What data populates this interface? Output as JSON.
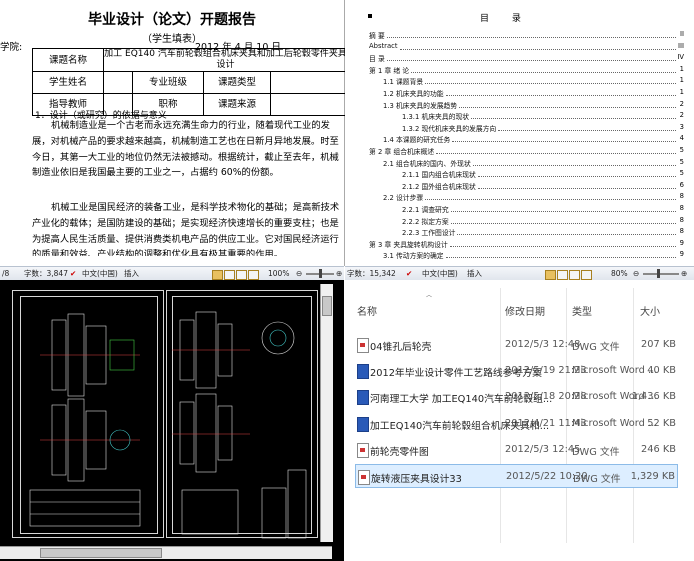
{
  "doc": {
    "title": "毕业设计（论文）开题报告",
    "subtitle": "（学生填表）",
    "school_label": "学院:",
    "date": "2012 年 4 月 10 日",
    "table": {
      "topic_label": "课题名称",
      "topic_value": "加工 EQ140 汽车前轮毂组合机床夹具和加工后轮毂零件夹具设计",
      "student_label": "学生姓名",
      "major_label": "专业班级",
      "type_label": "课题类型",
      "advisor_label": "指导教师",
      "title_label": "职称",
      "source_label": "课题来源"
    },
    "section_heading": "1．设计（或研究）的依据与意义",
    "para1": "机械制造业是一个古老而永远充满生命力的行业，随着现代工业的发展，对机械产品的要求越来越高，机械制造工艺也在日新月异地发展。时至今日，其第一大工业的地位仍然无法被撼动。根据统计，截止至去年，机械制造业依旧是我国最主要的工业之一，占据约 60%的份额。",
    "para2": "机械工业是国民经济的装备工业，是科学技术物化的基础；是高新技术产业化的载体；是国防建设的基础；是实现经济快速增长的重要支柱；也是为提高人民生活质量、提供消费类机电产品的供应工业。它对国民经济运行的质量和效益、产业结构的调整和优化具有极其重要的作用。",
    "status": {
      "page": "/8",
      "words": "字数：3,847",
      "lang": "中文(中国)",
      "mode": "插入",
      "zoom": "100%"
    }
  },
  "toc": {
    "title": "目 录",
    "entries": [
      {
        "text": "摘 要",
        "page": "II"
      },
      {
        "text": "Abstract",
        "page": "III"
      },
      {
        "text": "目 录",
        "page": "IV"
      },
      {
        "text": "第 1 章 绪 论",
        "page": "1"
      },
      {
        "text": "1.1 课题背景",
        "page": "1"
      },
      {
        "text": "1.2 机床夹具的功能",
        "page": "1"
      },
      {
        "text": "1.3 机床夹具的发展趋势",
        "page": "2"
      },
      {
        "text": "1.3.1 机床夹具的现状",
        "page": "2"
      },
      {
        "text": "1.3.2 现代机床夹具的发展方向",
        "page": "3"
      },
      {
        "text": "1.4 本课题的研究任务",
        "page": "4"
      },
      {
        "text": "第 2 章 组合机床概述",
        "page": "5"
      },
      {
        "text": "2.1 组合机床的国内、外现状",
        "page": "5"
      },
      {
        "text": "2.1.1 国内组合机床现状",
        "page": "5"
      },
      {
        "text": "2.1.2 国外组合机床现状",
        "page": "6"
      },
      {
        "text": "2.2 设计步骤",
        "page": "8"
      },
      {
        "text": "2.2.1 调查研究",
        "page": "8"
      },
      {
        "text": "2.2.2 拟定方案",
        "page": "8"
      },
      {
        "text": "2.2.3 工作图设计",
        "page": "8"
      },
      {
        "text": "第 3 章 夹具旋转机构设计",
        "page": "9"
      },
      {
        "text": "3.1 传动方案的确定",
        "page": "9"
      }
    ],
    "status": {
      "words": "字数：15,342",
      "lang": "中文(中国)",
      "mode": "插入",
      "zoom": "80%"
    }
  },
  "cad_status": {
    "words": "字数：3,847",
    "lang": "中文(中国)",
    "mode": "插入",
    "zoom": "100%"
  },
  "files": {
    "headers": {
      "name": "名称",
      "date": "修改日期",
      "type": "类型",
      "size": "大小"
    },
    "rows": [
      {
        "name": "04锥孔后轮壳",
        "date": "2012/5/3 12:48",
        "type": "DWG 文件",
        "size": "207 KB",
        "icon": "dwg-file-icon"
      },
      {
        "name": "2012年毕业设计零件工艺路线参考方案",
        "date": "2012/5/19 21:23",
        "type": "Microsoft Word ...",
        "size": "40 KB",
        "icon": "word-file-icon"
      },
      {
        "name": "河南理工大学 加工EQ140汽车前轮毂组...",
        "date": "2012/5/18 20:28",
        "type": "Microsoft Word ...",
        "size": "1,436 KB",
        "icon": "word-file-icon"
      },
      {
        "name": "加工EQ140汽车前轮毂组合机床夹具和...",
        "date": "2012/4/21 11:43",
        "type": "Microsoft Word ...",
        "size": "52 KB",
        "icon": "word-file-icon"
      },
      {
        "name": "前轮壳零件图",
        "date": "2012/5/3 12:45",
        "type": "DWG 文件",
        "size": "246 KB",
        "icon": "dwg-file-icon"
      },
      {
        "name": "旋转液压夹具设计33",
        "date": "2012/5/22 10:20",
        "type": "DWG 文件",
        "size": "1,329 KB",
        "icon": "dwg-file-icon"
      }
    ]
  },
  "colors": {
    "cad_background": "#000000",
    "status_bar": "#dfe4ec",
    "selection": "#ddeeff"
  }
}
